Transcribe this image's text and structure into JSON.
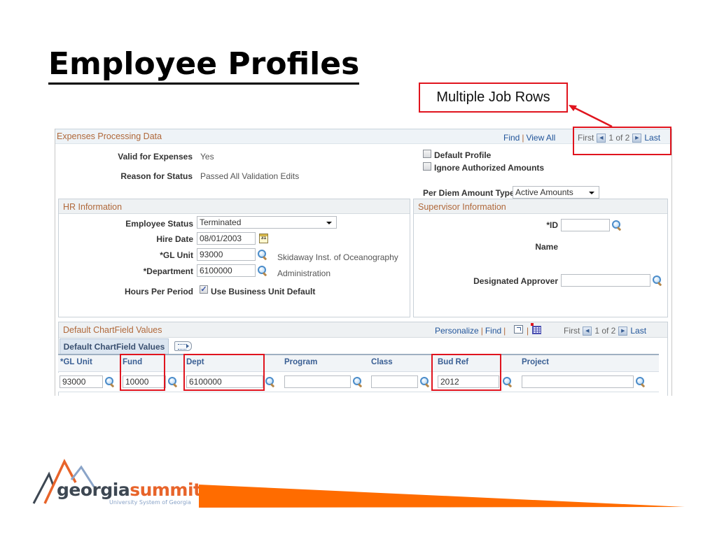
{
  "slide": {
    "title": "Employee Profiles",
    "callout": "Multiple Job Rows"
  },
  "expenses": {
    "title": "Expenses Processing Data",
    "find": "Find",
    "view_all": "View All",
    "nav": {
      "first": "First",
      "count": "1 of 2",
      "last": "Last"
    },
    "valid_label": "Valid for Expenses",
    "valid_value": "Yes",
    "reason_label": "Reason for Status",
    "reason_value": "Passed All Validation Edits",
    "default_profile": {
      "label": "Default Profile",
      "checked": false
    },
    "ignore_auth": {
      "label": "Ignore Authorized Amounts",
      "checked": false
    },
    "per_diem_label": "Per Diem Amount Type",
    "per_diem_value": "Active Amounts"
  },
  "hr": {
    "title": "HR Information",
    "status_label": "Employee Status",
    "status_value": "Terminated",
    "hire_label": "Hire Date",
    "hire_value": "08/01/2003",
    "calendar_glyph": "31",
    "gl_label": "*GL Unit",
    "gl_value": "93000",
    "gl_desc": "Skidaway Inst. of Oceanography",
    "dept_label": "*Department",
    "dept_value": "6100000",
    "dept_desc": "Administration",
    "hours_label": "Hours Per Period",
    "use_bu_default": {
      "label": "Use Business Unit Default",
      "checked": true,
      "mark": "✓"
    }
  },
  "supervisor": {
    "title": "Supervisor Information",
    "id_label": "*ID",
    "id_value": "",
    "name_label": "Name",
    "approver_label": "Designated Approver",
    "approver_value": ""
  },
  "chartfield": {
    "title": "Default ChartField Values",
    "personalize": "Personalize",
    "find": "Find",
    "nav": {
      "first": "First",
      "count": "1 of 2",
      "last": "Last"
    },
    "tab": "Default ChartField Values",
    "columns": [
      "*GL Unit",
      "Fund",
      "Dept",
      "Program",
      "Class",
      "Bud Ref",
      "Project"
    ],
    "row": [
      "93000",
      "10000",
      "6100000",
      "",
      "",
      "2012",
      ""
    ],
    "highlighted_columns": [
      "Fund",
      "Dept",
      "Bud Ref"
    ]
  },
  "footer": {
    "logo_word_1": "georgia",
    "logo_word_2": "summit",
    "logo_sub": "University System of Georgia"
  },
  "colors": {
    "highlight_red": "#e0141e",
    "group_title": "#b0683a",
    "link_blue": "#22559a",
    "brand_orange": "#ff6c00",
    "brand_slate": "#3d4752",
    "brand_light_blue": "#8aa4c8"
  }
}
